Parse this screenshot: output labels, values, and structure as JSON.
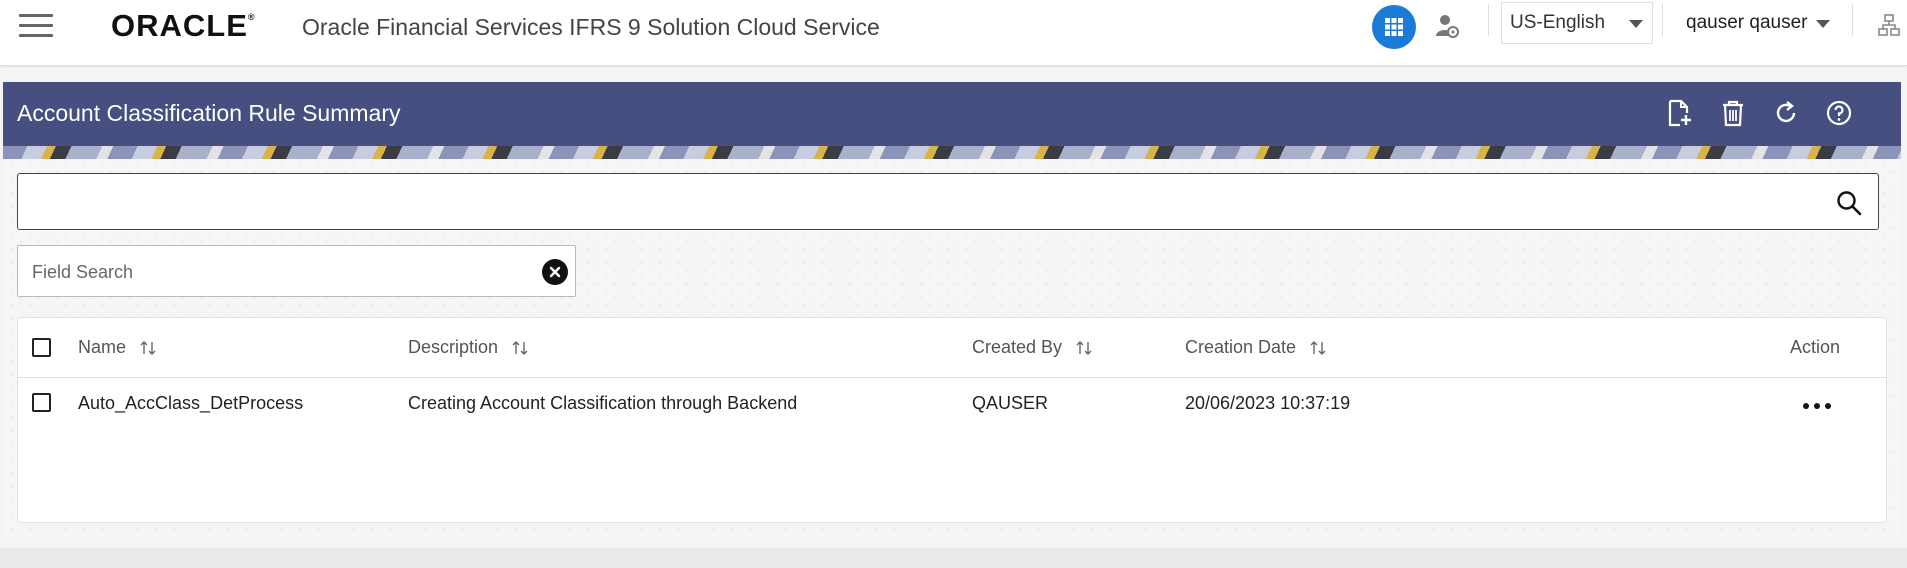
{
  "header": {
    "logo_text": "ORACLE",
    "app_title": "Oracle Financial Services IFRS 9 Solution Cloud Service",
    "language": "US-English",
    "user": "qauser qauser",
    "accent_color": "#1a7bd8"
  },
  "page": {
    "title": "Account Classification Rule Summary",
    "title_bar_color": "#474f80",
    "actions": [
      "add-icon",
      "delete-icon",
      "refresh-icon",
      "help-icon"
    ]
  },
  "search": {
    "value": "",
    "placeholder": ""
  },
  "field_search": {
    "placeholder": "Field Search"
  },
  "table": {
    "columns": [
      "Name",
      "Description",
      "Created By",
      "Creation Date",
      "Action"
    ],
    "rows": [
      {
        "name": "Auto_AccClass_DetProcess",
        "description": "Creating Account Classification through Backend",
        "created_by": "QAUSER",
        "creation_date": "20/06/2023 10:37:19"
      }
    ]
  }
}
